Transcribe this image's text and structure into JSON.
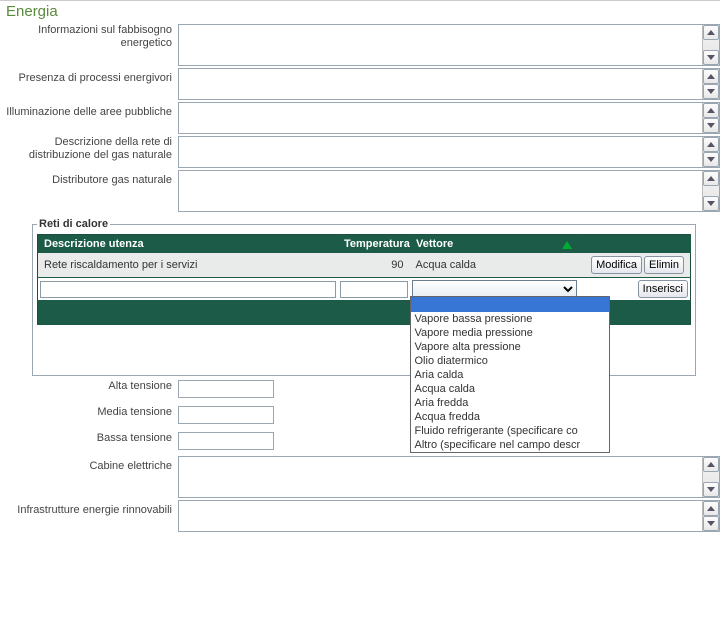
{
  "section_title": "Energia",
  "fields": {
    "fabbisogno_label": "Informazioni sul fabbisogno energetico",
    "energivori_label": "Presenza di processi energivori",
    "illuminazione_label": "Illuminazione delle aree pubbliche",
    "rete_gas_label": "Descrizione della rete di distribuzione del gas naturale",
    "distributore_gas_label": "Distributore gas naturale",
    "alta_tensione_label": "Alta tensione",
    "media_tensione_label": "Media tensione",
    "bassa_tensione_label": "Bassa tensione",
    "cabine_label": "Cabine elettriche",
    "rinnovabili_label": "Infrastrutture energie rinnovabili",
    "fabbisogno_value": "",
    "energivori_value": "",
    "illuminazione_value": "",
    "rete_gas_value": "",
    "distributore_gas_value": "",
    "alta_tensione_value": "",
    "media_tensione_value": "",
    "bassa_tensione_value": "",
    "cabine_value": "",
    "rinnovabili_value": ""
  },
  "reti": {
    "legend": "Reti di calore",
    "col_descrizione": "Descrizione utenza",
    "col_temperatura": "Temperatura",
    "col_vettore": "Vettore",
    "btn_modifica": "Modifica",
    "btn_elimina": "Elimin",
    "btn_inserisci": "Inserisci",
    "row1": {
      "descrizione": "Rete riscaldamento per i servizi",
      "temperatura": "90",
      "vettore": "Acqua calda"
    },
    "new": {
      "descrizione": "",
      "temperatura": ""
    }
  },
  "dropdown": {
    "selected": "",
    "options": [
      "Vapore bassa pressione",
      "Vapore media pressione",
      "Vapore alta pressione",
      "Olio diatermico",
      "Aria calda",
      "Acqua calda",
      "Aria fredda",
      "Acqua fredda",
      "Fluido refrigerante (specificare co",
      "Altro (specificare nel campo descr"
    ]
  }
}
